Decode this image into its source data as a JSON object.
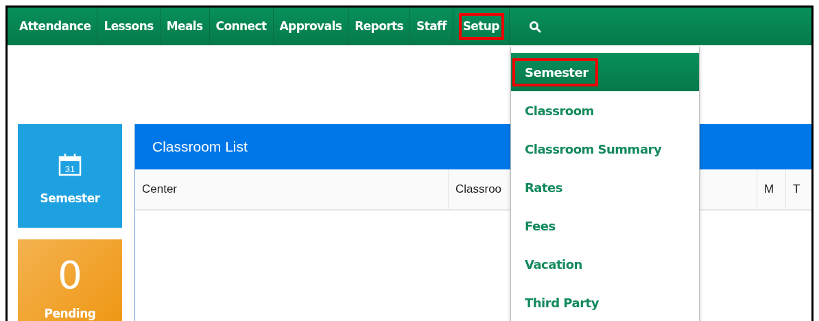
{
  "nav": {
    "items": [
      {
        "label": "Attendance",
        "highlighted": false
      },
      {
        "label": "Lessons",
        "highlighted": false
      },
      {
        "label": "Meals",
        "highlighted": false
      },
      {
        "label": "Connect",
        "highlighted": false
      },
      {
        "label": "Approvals",
        "highlighted": false
      },
      {
        "label": "Reports",
        "highlighted": false
      },
      {
        "label": "Staff",
        "highlighted": false
      },
      {
        "label": "Setup",
        "highlighted": true
      }
    ]
  },
  "setup_menu": {
    "items": [
      {
        "label": "Semester",
        "selected": true,
        "highlighted": true
      },
      {
        "label": "Classroom",
        "selected": false,
        "highlighted": false
      },
      {
        "label": "Classroom Summary",
        "selected": false,
        "highlighted": false
      },
      {
        "label": "Rates",
        "selected": false,
        "highlighted": false
      },
      {
        "label": "Fees",
        "selected": false,
        "highlighted": false
      },
      {
        "label": "Vacation",
        "selected": false,
        "highlighted": false
      },
      {
        "label": "Third Party",
        "selected": false,
        "highlighted": false
      }
    ]
  },
  "tiles": [
    {
      "kind": "icon",
      "label": "Semester",
      "icon_text": "31"
    },
    {
      "kind": "count",
      "value": "0",
      "label": "Pending"
    }
  ],
  "table": {
    "title": "Classroom List",
    "columns": [
      "Center",
      "Classroo",
      "M",
      "T"
    ]
  }
}
